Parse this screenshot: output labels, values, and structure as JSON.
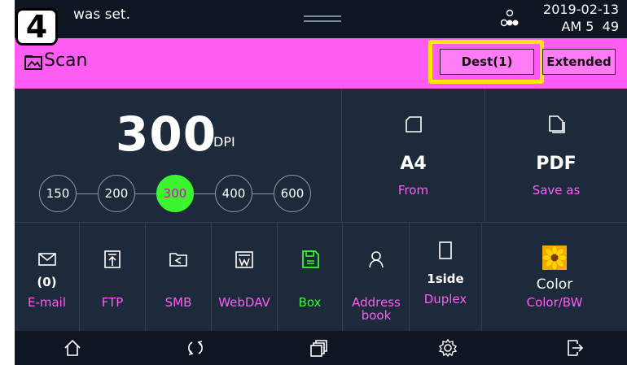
{
  "step_badge": "4",
  "status": {
    "message": "was set.",
    "date": "2019-02-13",
    "time": "AM 5  49"
  },
  "header": {
    "title": "Scan",
    "dest_label": "Dest(1)",
    "extended_label": "Extended"
  },
  "resolution": {
    "value": "300",
    "unit": "DPI",
    "options": [
      "150",
      "200",
      "300",
      "400",
      "600"
    ],
    "selected": "300"
  },
  "tiles": {
    "from": {
      "value": "A4",
      "label": "From",
      "icon": "paper-size-icon"
    },
    "save_as": {
      "value": "PDF",
      "label": "Save as",
      "icon": "document-icon"
    }
  },
  "functions": {
    "email": {
      "count": "(0)",
      "label": "E-mail",
      "icon": "envelope-icon"
    },
    "ftp": {
      "label": "FTP",
      "icon": "upload-icon"
    },
    "smb": {
      "label": "SMB",
      "icon": "share-folder-icon"
    },
    "webdav": {
      "label": "WebDAV",
      "icon": "webdav-icon"
    },
    "box": {
      "label": "Box",
      "icon": "save-icon"
    },
    "address_book": {
      "label": "Address book",
      "icon": "person-icon"
    },
    "duplex": {
      "value": "1side",
      "label": "Duplex",
      "icon": "page-icon"
    },
    "color": {
      "value": "Color",
      "label": "Color/BW",
      "icon": "flower-icon"
    }
  },
  "nav": [
    "home-icon",
    "reset-icon",
    "copy-job-icon",
    "settings-icon",
    "logout-icon"
  ],
  "colors": {
    "accent": "#ff5cf3",
    "selected": "#3df52e",
    "highlight": "#ffe800",
    "panel": "#1d2a3b"
  }
}
